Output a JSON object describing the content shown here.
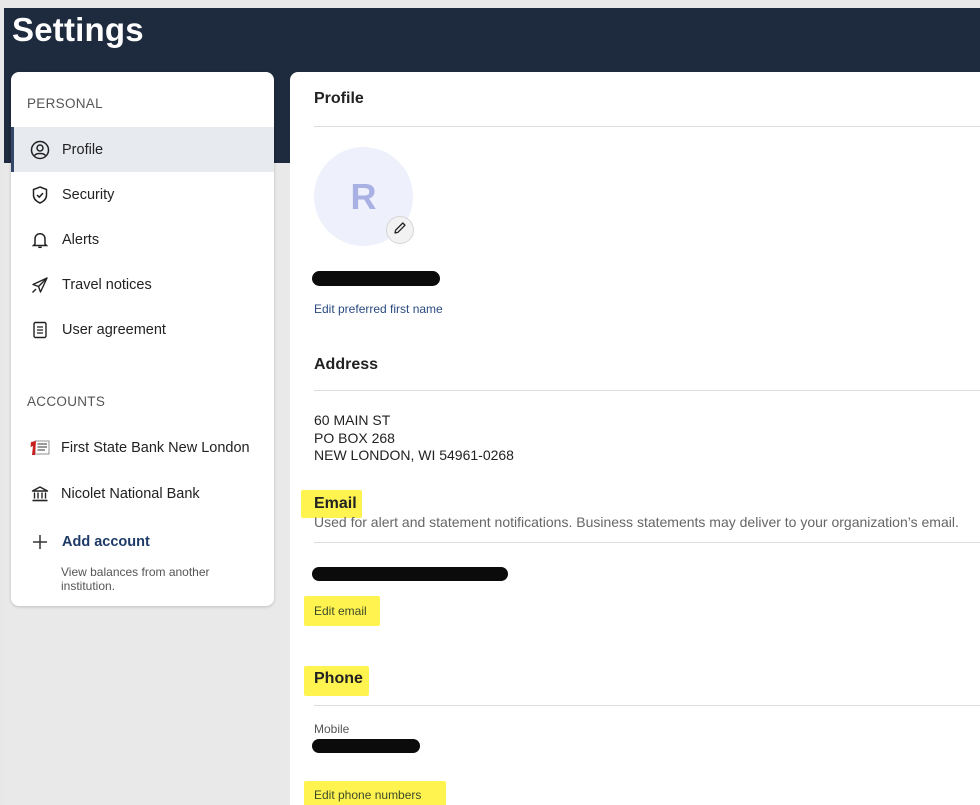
{
  "page": {
    "title": "Settings"
  },
  "sidebar": {
    "personal_label": "PERSONAL",
    "personal_items": [
      {
        "label": "Profile",
        "icon": "user-circle-icon",
        "active": true
      },
      {
        "label": "Security",
        "icon": "shield-check-icon"
      },
      {
        "label": "Alerts",
        "icon": "bell-icon"
      },
      {
        "label": "Travel notices",
        "icon": "airplane-icon"
      },
      {
        "label": "User agreement",
        "icon": "document-icon"
      }
    ],
    "accounts_label": "ACCOUNTS",
    "accounts": [
      {
        "label": "First State Bank New London",
        "icon": "first-state-bank-logo"
      },
      {
        "label": "Nicolet National Bank",
        "icon": "bank-building-icon"
      }
    ],
    "add_account": {
      "label": "Add account",
      "sub": "View balances from another institution."
    }
  },
  "profile": {
    "title": "Profile",
    "avatar_initial": "R",
    "edit_name_link": "Edit preferred first name"
  },
  "address": {
    "title": "Address",
    "line1": "60 MAIN ST",
    "line2": "PO BOX 268",
    "line3": "NEW LONDON, WI 54961-0268"
  },
  "email": {
    "title": "Email",
    "description": "Used for alert and statement notifications. Business statements may deliver to your organization’s email.",
    "edit_link": "Edit email"
  },
  "phone": {
    "title": "Phone",
    "mobile_label": "Mobile",
    "edit_link": "Edit phone numbers"
  },
  "colors": {
    "header": "#1e2b3e",
    "active_bg": "#e7eaef",
    "link": "#2a4a80",
    "highlight": "#fff34f"
  }
}
